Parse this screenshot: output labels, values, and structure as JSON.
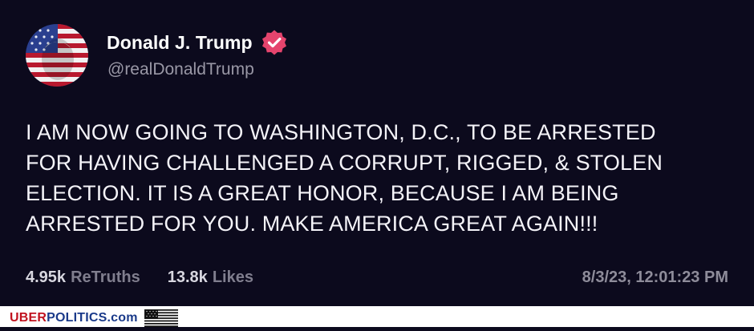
{
  "post": {
    "display_name": "Donald J. Trump",
    "handle": "@realDonaldTrump",
    "verified_icon": "verified-badge-icon",
    "avatar_icon": "flag-painted-face-avatar",
    "text_lines": [
      "I AM NOW GOING TO WASHINGTON, D.C., TO BE ARRESTED",
      "FOR HAVING CHALLENGED A CORRUPT, RIGGED, & STOLEN",
      "ELECTION. IT IS A GREAT HONOR, BECAUSE I AM BEING",
      "ARRESTED FOR YOU. MAKE AMERICA GREAT AGAIN!!!"
    ],
    "retruths_count": "4.95k",
    "retruths_label": "ReTruths",
    "likes_count": "13.8k",
    "likes_label": "Likes",
    "timestamp": "8/3/23, 12:01:23 PM"
  },
  "footer": {
    "watermark_uber": "UBER",
    "watermark_politics": "POLITICS",
    "watermark_com": ".com",
    "flag_icon": "us-flag-icon"
  },
  "colors": {
    "background": "#0c0a1d",
    "verified_badge": "#e5446d",
    "watermark_red": "#c1121f",
    "watermark_blue": "#1a3a8a"
  }
}
